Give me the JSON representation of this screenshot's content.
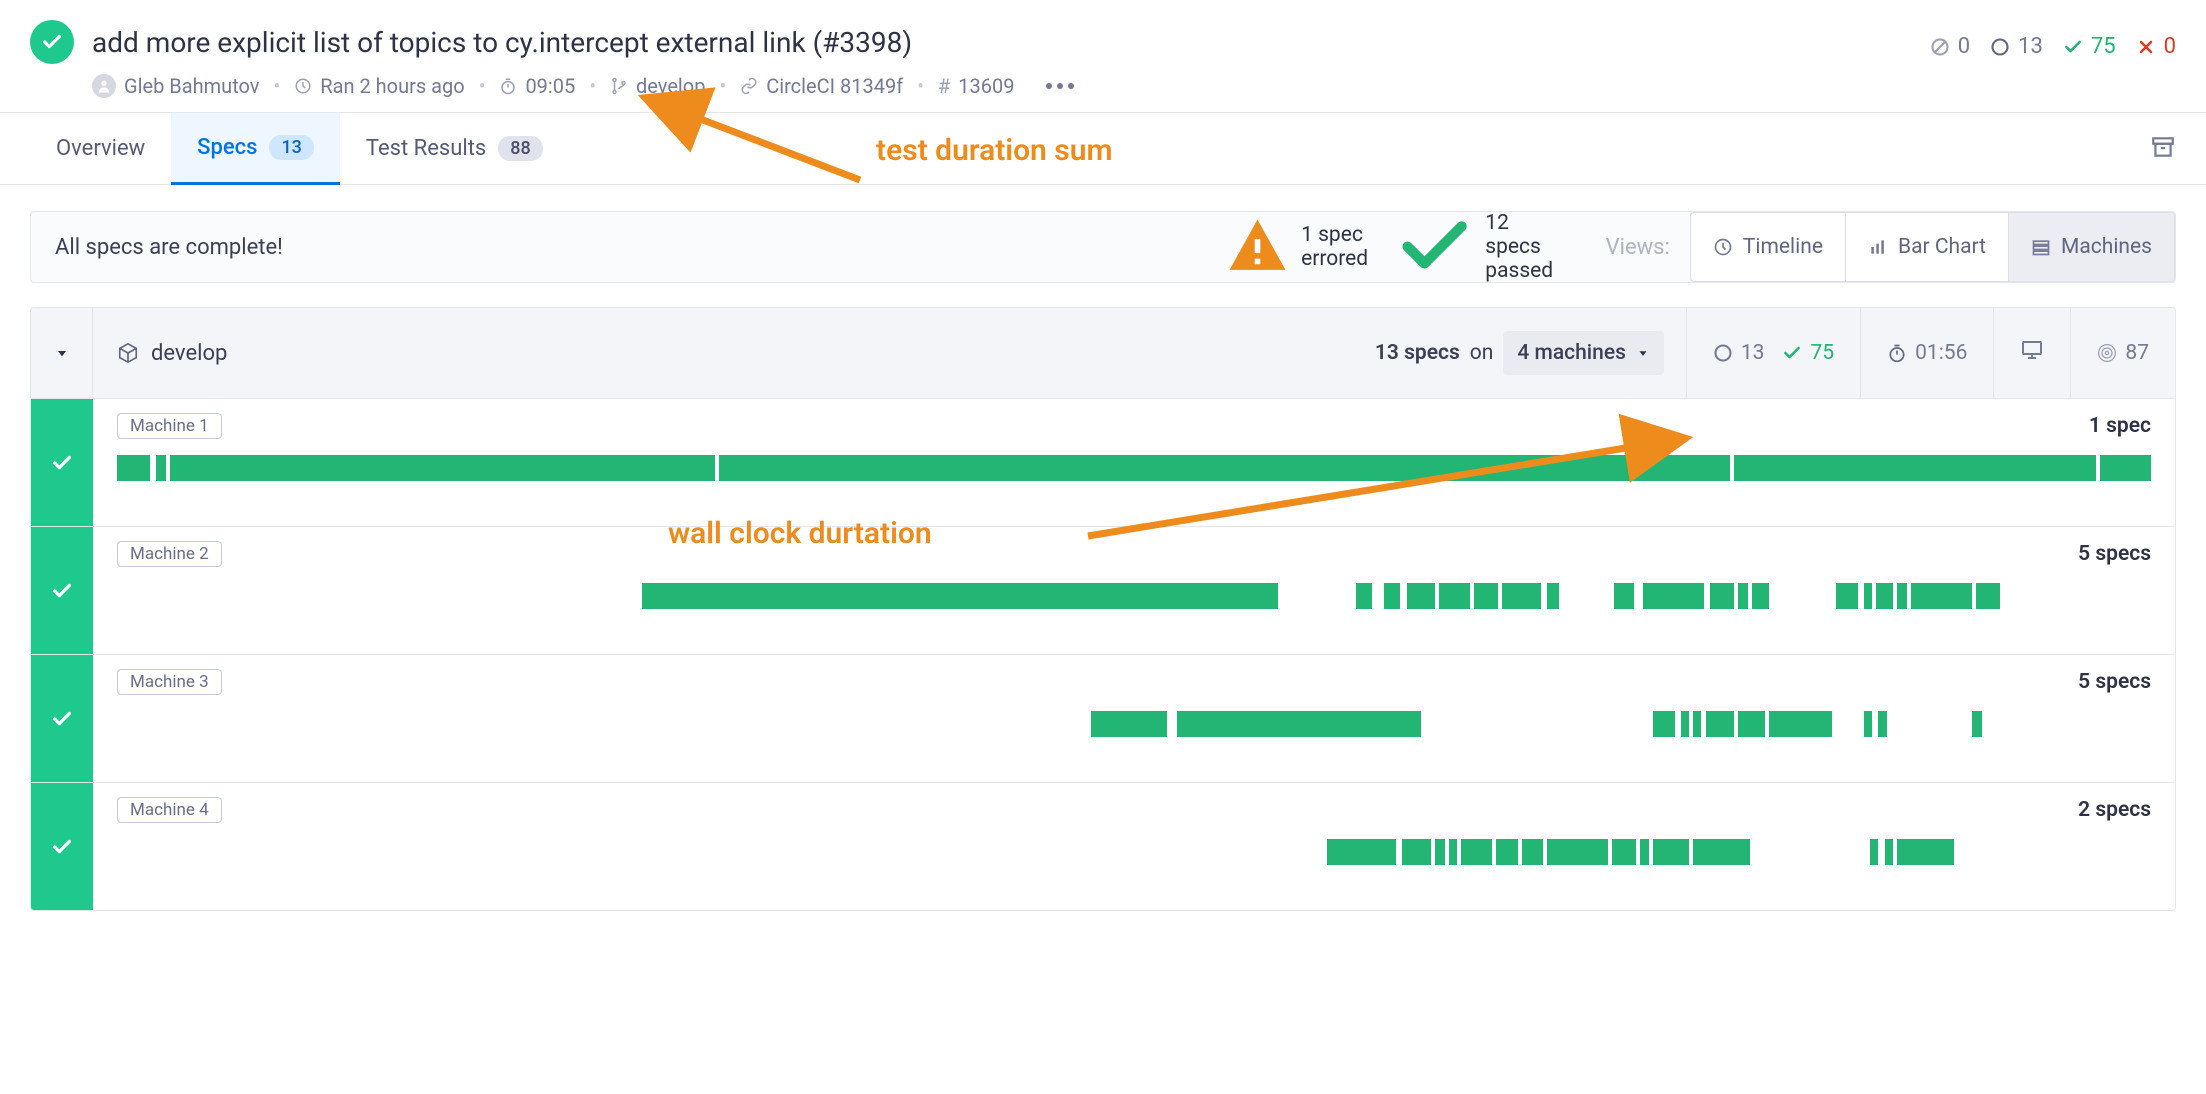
{
  "header": {
    "title": "add more explicit list of topics to cy.intercept external link (#3398)",
    "author": "Gleb Bahmutov",
    "ran_ago": "Ran 2 hours ago",
    "duration": "09:05",
    "branch": "develop",
    "ci": "CircleCI 81349f",
    "run_number": "13609",
    "stats": {
      "skipped": "0",
      "pending": "13",
      "passed": "75",
      "failed": "0"
    }
  },
  "tabs": {
    "overview": "Overview",
    "specs": "Specs",
    "specs_count": "13",
    "results": "Test Results",
    "results_count": "88"
  },
  "summary": {
    "complete_msg": "All specs are complete!",
    "errored": "1 spec errored",
    "passed": "12 specs passed",
    "views_label": "Views:",
    "timeline": "Timeline",
    "bar_chart": "Bar Chart",
    "machines": "Machines"
  },
  "group": {
    "branch": "develop",
    "spec_count": "13 specs",
    "on_label": "on",
    "machines_count": "4 machines",
    "pending": "13",
    "passed": "75",
    "wall_clock": "01:56",
    "env": "87"
  },
  "machines": [
    {
      "label": "Machine 1",
      "specs": "1 spec",
      "segs": [
        [
          0,
          1.6
        ],
        [
          1.9,
          0.5
        ],
        [
          2.6,
          26.8
        ],
        [
          29.6,
          49.7
        ],
        [
          79.5,
          17.8
        ],
        [
          97.5,
          2.5
        ]
      ]
    },
    {
      "label": "Machine 2",
      "specs": "5 specs",
      "segs": [
        [
          25.8,
          31.3
        ],
        [
          60.9,
          0.8
        ],
        [
          62.3,
          0.8
        ],
        [
          63.4,
          1.4
        ],
        [
          65.0,
          1.5
        ],
        [
          66.7,
          1.2
        ],
        [
          68.1,
          1.9
        ],
        [
          70.3,
          0.6
        ],
        [
          73.6,
          1.0
        ],
        [
          75.0,
          3.0
        ],
        [
          78.3,
          1.2
        ],
        [
          79.7,
          0.5
        ],
        [
          80.4,
          0.8
        ],
        [
          84.5,
          1.1
        ],
        [
          85.9,
          0.4
        ],
        [
          86.5,
          0.8
        ],
        [
          87.5,
          0.5
        ],
        [
          88.2,
          3.0
        ],
        [
          91.4,
          1.2
        ]
      ]
    },
    {
      "label": "Machine 3",
      "specs": "5 specs",
      "segs": [
        [
          47.9,
          3.7
        ],
        [
          52.1,
          12.0
        ],
        [
          75.5,
          1.1
        ],
        [
          76.9,
          0.4
        ],
        [
          77.5,
          0.4
        ],
        [
          78.1,
          1.4
        ],
        [
          79.7,
          1.3
        ],
        [
          81.2,
          3.1
        ],
        [
          85.9,
          0.4
        ],
        [
          86.6,
          0.4
        ],
        [
          91.2,
          0.5
        ]
      ]
    },
    {
      "label": "Machine 4",
      "specs": "2 specs",
      "segs": [
        [
          59.5,
          3.4
        ],
        [
          63.2,
          1.4
        ],
        [
          64.8,
          0.5
        ],
        [
          65.5,
          0.4
        ],
        [
          66.1,
          1.5
        ],
        [
          67.8,
          1.1
        ],
        [
          69.1,
          1.0
        ],
        [
          70.3,
          3.0
        ],
        [
          73.5,
          1.2
        ],
        [
          74.9,
          0.4
        ],
        [
          75.5,
          1.8
        ],
        [
          77.5,
          2.8
        ],
        [
          86.2,
          0.4
        ],
        [
          86.9,
          0.4
        ],
        [
          87.5,
          2.8
        ]
      ]
    }
  ],
  "annotations": {
    "sum": "test duration sum",
    "wall": "wall clock durtation"
  }
}
